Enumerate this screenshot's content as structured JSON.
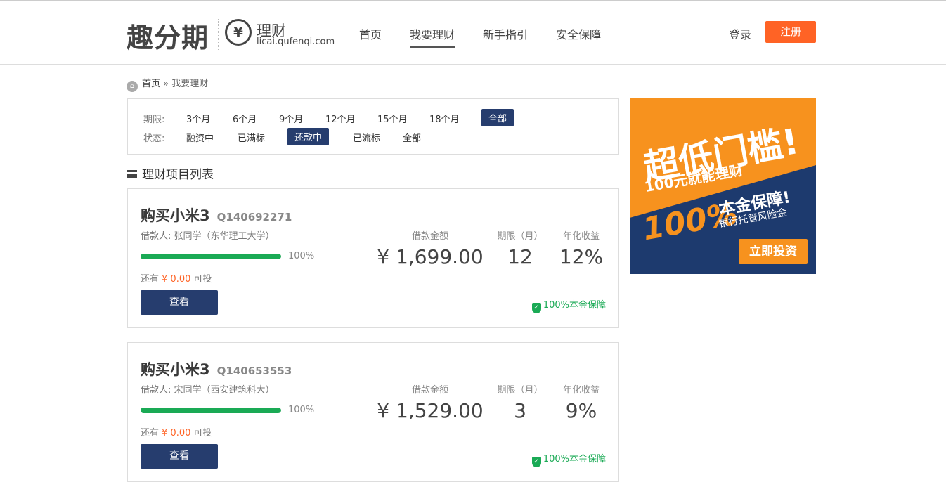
{
  "header": {
    "brand": "趣分期",
    "licai_title": "理财",
    "licai_url": "licai.qufenqi.com",
    "yen_symbol": "¥",
    "nav": [
      {
        "label": "首页",
        "active": false
      },
      {
        "label": "我要理财",
        "active": true
      },
      {
        "label": "新手指引",
        "active": false
      },
      {
        "label": "安全保障",
        "active": false
      }
    ],
    "login": "登录",
    "register": "注册"
  },
  "breadcrumb": {
    "home": "首页",
    "sep": "»",
    "current": "我要理财"
  },
  "filter": {
    "period_label": "期限:",
    "period_options": [
      "3个月",
      "6个月",
      "9个月",
      "12个月",
      "15个月",
      "18个月",
      "全部"
    ],
    "period_selected": "全部",
    "status_label": "状态:",
    "status_options": [
      "融资中",
      "已满标",
      "还款中",
      "已流标",
      "全部"
    ],
    "status_selected": "还款中"
  },
  "list_title": "理财项目列表",
  "col_headers": {
    "amount": "借款金额",
    "term": "期限（月）",
    "rate": "年化收益"
  },
  "projects": [
    {
      "name": "购买小米3",
      "code": "Q140692271",
      "borrower": "借款人: 张同学（东华理工大学）",
      "progress_pct": 100,
      "progress_label": "100%",
      "remain_prefix": "还有",
      "remain_amount": "¥ 0.00",
      "remain_suffix": "可投",
      "view": "查看",
      "amount": "¥ 1,699.00",
      "term": "12",
      "rate": "12%",
      "guarantee": "100%本金保障"
    },
    {
      "name": "购买小米3",
      "code": "Q140653553",
      "borrower": "借款人: 宋同学（西安建筑科大）",
      "progress_pct": 100,
      "progress_label": "100%",
      "remain_prefix": "还有",
      "remain_amount": "¥ 0.00",
      "remain_suffix": "可投",
      "view": "查看",
      "amount": "¥ 1,529.00",
      "term": "3",
      "rate": "9%",
      "guarantee": "100%本金保障"
    }
  ],
  "ad": {
    "headline": "超低门槛!",
    "subline": "100元就能理财",
    "pct": "100%",
    "guarantee": "本金保障!",
    "bank": "银行托管风险金",
    "button": "立即投资"
  },
  "colors": {
    "accent": "#ff6325",
    "navy": "#263d6e",
    "green": "#1aaa55",
    "ad_orange": "#f7921e",
    "ad_blue": "#1d3a6e"
  }
}
